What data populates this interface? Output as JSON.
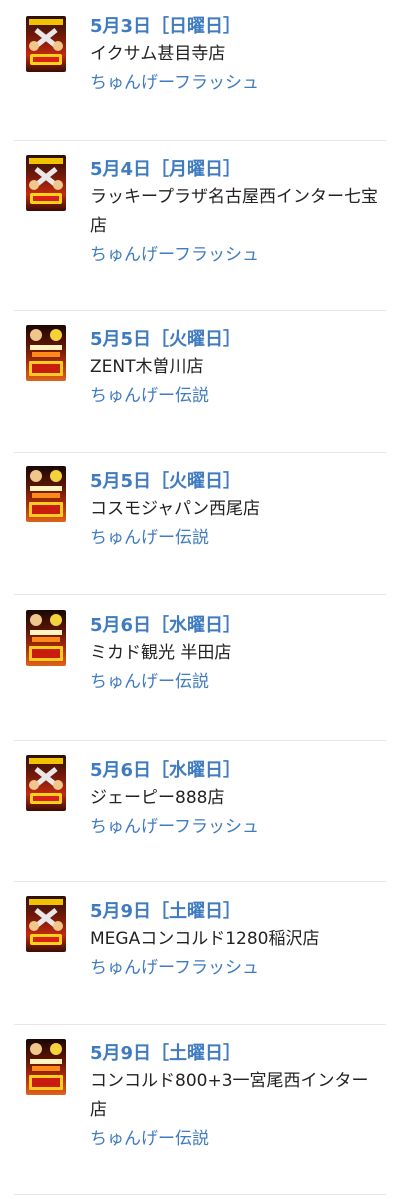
{
  "items": [
    {
      "date": "5月3日［日曜日］",
      "store": "イクサム甚目寺店",
      "event": "ちゅんげーフラッシュ",
      "thumb": "flash-poster"
    },
    {
      "date": "5月4日［月曜日］",
      "store": "ラッキープラザ名古屋西インター七宝店",
      "event": "ちゅんげーフラッシュ",
      "thumb": "flash-poster"
    },
    {
      "date": "5月5日［火曜日］",
      "store": "ZENT木曽川店",
      "event": "ちゅんげー伝説",
      "thumb": "legend-poster"
    },
    {
      "date": "5月5日［火曜日］",
      "store": "コスモジャパン西尾店",
      "event": "ちゅんげー伝説",
      "thumb": "legend-poster"
    },
    {
      "date": "5月6日［水曜日］",
      "store": "ミカド観光 半田店",
      "event": "ちゅんげー伝説",
      "thumb": "legend-poster"
    },
    {
      "date": "5月6日［水曜日］",
      "store": "ジェーピー888店",
      "event": "ちゅんげーフラッシュ",
      "thumb": "flash-poster"
    },
    {
      "date": "5月9日［土曜日］",
      "store": "MEGAコンコルド1280稲沢店",
      "event": "ちゅんげーフラッシュ",
      "thumb": "flash-poster"
    },
    {
      "date": "5月9日［土曜日］",
      "store": "コンコルド800+3一宮尾西インター店",
      "event": "ちゅんげー伝説",
      "thumb": "legend-poster"
    }
  ],
  "colors": {
    "date": "#3f7bc0",
    "event_link": "#3f7bc0",
    "store_text": "#222222",
    "divider": "#e6e6e6"
  }
}
